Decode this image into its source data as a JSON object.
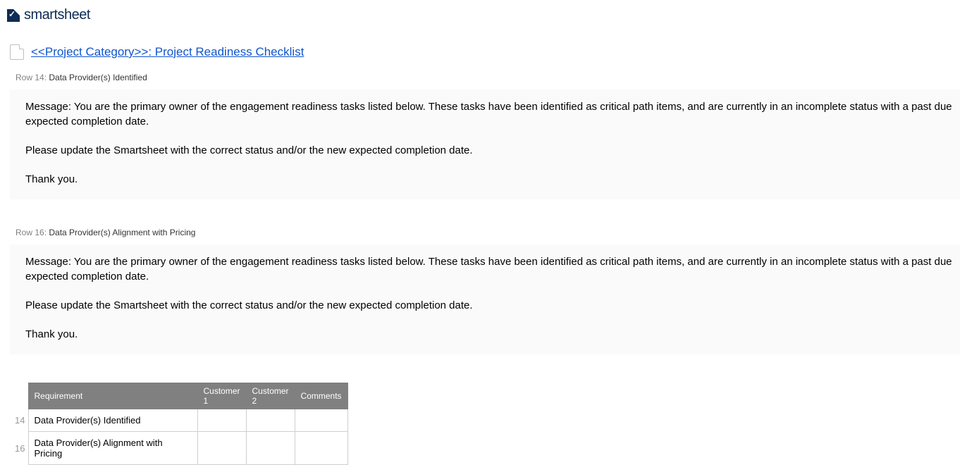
{
  "logo": {
    "text": "smartsheet"
  },
  "sheet": {
    "title": "<<Project Category>>: Project Readiness Checklist"
  },
  "rows": [
    {
      "row_prefix": "Row 14:",
      "row_title": "Data Provider(s) Identified",
      "message_p1": "Message: You are the primary owner of the engagement readiness tasks listed below. These tasks have been identified as critical path items, and are currently in an incomplete status with a past due expected completion date.",
      "message_p2": "Please update the Smartsheet with the correct status and/or the new expected completion date.",
      "message_p3": "Thank you."
    },
    {
      "row_prefix": "Row 16:",
      "row_title": "Data Provider(s) Alignment with Pricing",
      "message_p1": "Message: You are the primary owner of the engagement readiness tasks listed below. These tasks have been identified as critical path items, and are currently in an incomplete status with a past due expected completion date.",
      "message_p2": "Please update the Smartsheet with the correct status and/or the new expected completion date.",
      "message_p3": "Thank you."
    }
  ],
  "table": {
    "headers": {
      "requirement": "Requirement",
      "customer1": "Customer 1",
      "customer2": "Customer 2",
      "comments": "Comments"
    },
    "rows": [
      {
        "num": "14",
        "requirement": "Data Provider(s) Identified",
        "c1": "",
        "c2": "",
        "com": ""
      },
      {
        "num": "16",
        "requirement": "Data Provider(s) Alignment with Pricing",
        "c1": "",
        "c2": "",
        "com": ""
      }
    ]
  }
}
